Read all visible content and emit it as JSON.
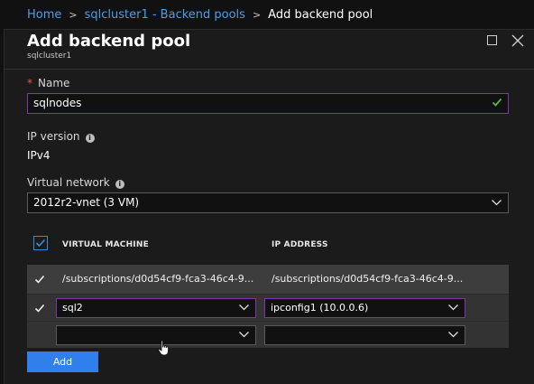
{
  "breadcrumb": {
    "home": "Home",
    "parent": "sqlcluster1 - Backend pools",
    "current": "Add backend pool",
    "separator": ">"
  },
  "blade": {
    "title": "Add backend pool",
    "subtitle": "sqlcluster1"
  },
  "name_field": {
    "required_mark": "*",
    "label": "Name",
    "value": "sqlnodes"
  },
  "ip_version": {
    "label": "IP version",
    "value": "IPv4"
  },
  "virtual_network": {
    "label": "Virtual network",
    "selected": "2012r2-vnet (3 VM)"
  },
  "table": {
    "columns": [
      "VIRTUAL MACHINE",
      "IP ADDRESS"
    ],
    "rows": [
      {
        "vm": "/subscriptions/d0d54cf9-fca3-46c4-9...",
        "ip": "/subscriptions/d0d54cf9-fca3-46c4-9...",
        "checked": true
      },
      {
        "vm": "sql2",
        "ip": "ipconfig1 (10.0.0.6)",
        "checked": true
      },
      {
        "vm": "",
        "ip": "",
        "checked": false
      }
    ]
  },
  "add_button": "Add",
  "colors": {
    "accent": "#2f80ed",
    "link": "#4a9fea",
    "focus_border": "#7a3aa6",
    "valid_check": "#58b83f",
    "required": "#e8554e"
  },
  "icons": [
    "chevron-right-icon",
    "maximize-icon",
    "close-icon",
    "info-icon",
    "checkmark-icon",
    "chevron-down-icon",
    "hand-cursor-icon"
  ]
}
